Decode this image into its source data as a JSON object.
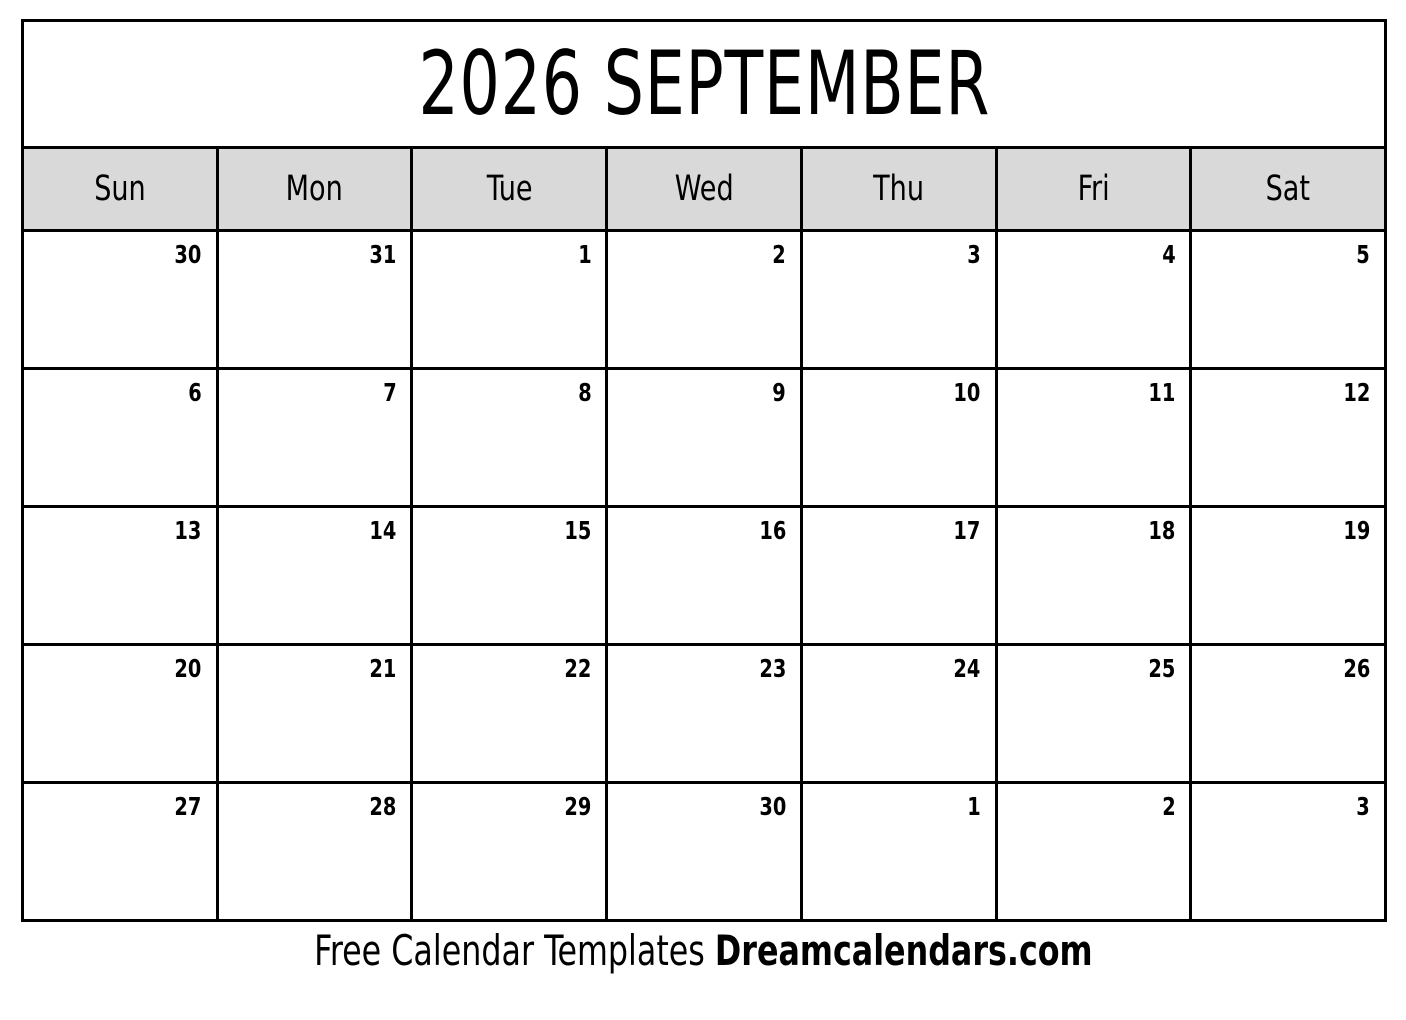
{
  "calendar": {
    "title": "2026 SEPTEMBER",
    "year": "2026",
    "month": "SEPTEMBER",
    "colors": {
      "header_background": "#d9d9d9",
      "cell_background": "#ffffff",
      "border": "#000000",
      "text": "#000000"
    },
    "weekdays": [
      {
        "label": "Sun"
      },
      {
        "label": "Mon"
      },
      {
        "label": "Tue"
      },
      {
        "label": "Wed"
      },
      {
        "label": "Thu"
      },
      {
        "label": "Fri"
      },
      {
        "label": "Sat"
      }
    ],
    "weeks": [
      {
        "days": [
          {
            "number": "30"
          },
          {
            "number": "31"
          },
          {
            "number": "1"
          },
          {
            "number": "2"
          },
          {
            "number": "3"
          },
          {
            "number": "4"
          },
          {
            "number": "5"
          }
        ]
      },
      {
        "days": [
          {
            "number": "6"
          },
          {
            "number": "7"
          },
          {
            "number": "8"
          },
          {
            "number": "9"
          },
          {
            "number": "10"
          },
          {
            "number": "11"
          },
          {
            "number": "12"
          }
        ]
      },
      {
        "days": [
          {
            "number": "13"
          },
          {
            "number": "14"
          },
          {
            "number": "15"
          },
          {
            "number": "16"
          },
          {
            "number": "17"
          },
          {
            "number": "18"
          },
          {
            "number": "19"
          }
        ]
      },
      {
        "days": [
          {
            "number": "20"
          },
          {
            "number": "21"
          },
          {
            "number": "22"
          },
          {
            "number": "23"
          },
          {
            "number": "24"
          },
          {
            "number": "25"
          },
          {
            "number": "26"
          }
        ]
      },
      {
        "days": [
          {
            "number": "27"
          },
          {
            "number": "28"
          },
          {
            "number": "29"
          },
          {
            "number": "30"
          },
          {
            "number": "1"
          },
          {
            "number": "2"
          },
          {
            "number": "3"
          }
        ]
      }
    ]
  },
  "footer": {
    "tagline": "Free Calendar Templates",
    "brand": "Dreamcalendars.com"
  }
}
